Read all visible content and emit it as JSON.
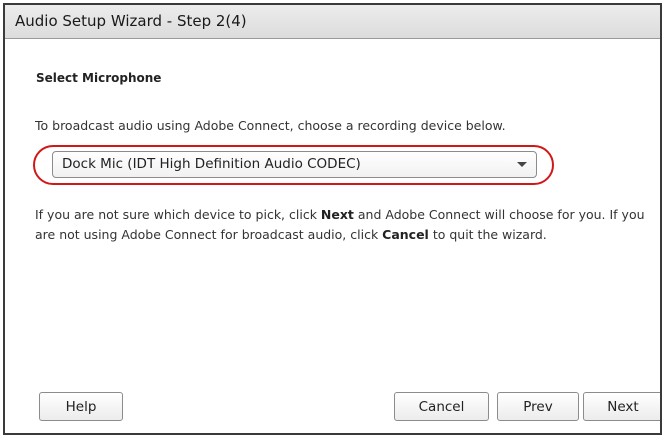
{
  "dialog": {
    "title": "Audio Setup Wizard - Step 2(4)",
    "heading": "Select Microphone",
    "instruction": "To broadcast audio using Adobe Connect, choose a recording device below.",
    "microphone_select": {
      "selected": "Dock Mic (IDT High Definition Audio CODEC)"
    },
    "help_text": {
      "part1": "If you are not sure which device to pick, click ",
      "next_word": "Next",
      "part2": " and Adobe Connect will choose for you. If you are not using Adobe Connect for broadcast audio, click ",
      "cancel_word": "Cancel",
      "part3": " to quit the wizard."
    },
    "buttons": {
      "help": "Help",
      "cancel": "Cancel",
      "prev": "Prev",
      "next": "Next"
    },
    "highlight_color": "#d01818"
  }
}
